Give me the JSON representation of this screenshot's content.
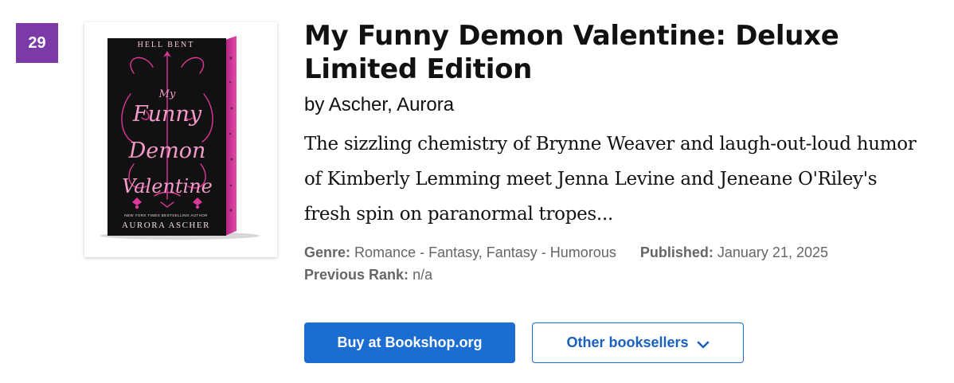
{
  "rank": "29",
  "book": {
    "title": "My Funny Demon Valentine: Deluxe Limited Edition",
    "author_line": "by Ascher, Aurora",
    "description": "The sizzling chemistry of Brynne Weaver and laugh-out-loud humor of Kimberly Lemming meet Jenna Levine and Jeneane O'Riley's fresh spin on paranormal tropes...",
    "cover": {
      "series": "HELL BENT",
      "title_lines": [
        "My",
        "Funny",
        "Demon",
        "Valentine"
      ],
      "blurb": "NEW YORK TIMES BESTSELLING AUTHOR",
      "author": "AURORA ASCHER",
      "colors": {
        "background": "#111111",
        "accent": "#e0379b",
        "edge": "#d2389b"
      }
    }
  },
  "meta": {
    "genre_label": "Genre:",
    "genre_value": "Romance - Fantasy, Fantasy - Humorous",
    "published_label": "Published:",
    "published_value": "January 21, 2025",
    "previous_rank_label": "Previous Rank:",
    "previous_rank_value": "n/a"
  },
  "actions": {
    "buy_label": "Buy at Bookshop.org",
    "other_label": "Other booksellers",
    "other_icon": "chevron-down-icon"
  },
  "colors": {
    "rank_badge": "#7b3aa8",
    "primary_button": "#1b6dd1",
    "meta_text": "#666666"
  }
}
